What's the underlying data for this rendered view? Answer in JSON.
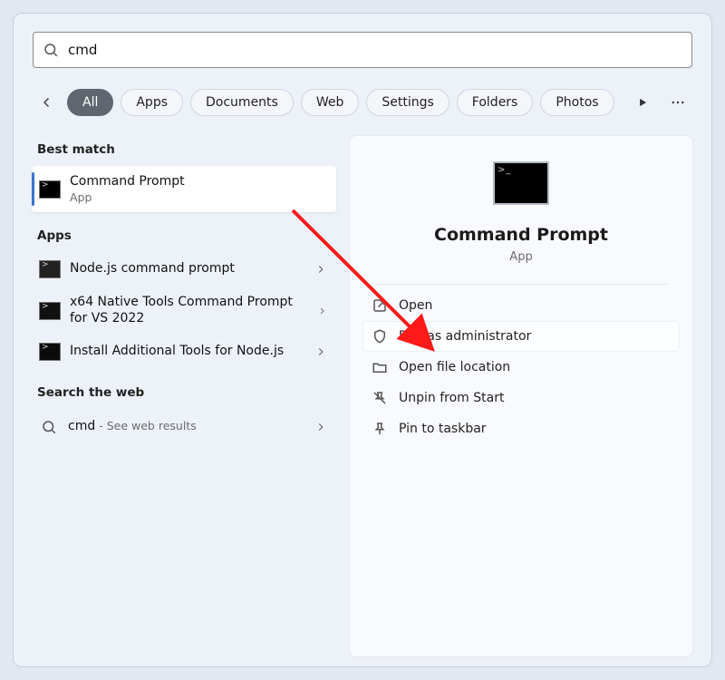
{
  "search": {
    "query": "cmd"
  },
  "filters": {
    "items": [
      "All",
      "Apps",
      "Documents",
      "Web",
      "Settings",
      "Folders",
      "Photos"
    ],
    "active_index": 0
  },
  "sections": {
    "best_match": "Best match",
    "apps": "Apps",
    "web": "Search the web"
  },
  "best": {
    "title": "Command Prompt",
    "subtitle": "App"
  },
  "apps": [
    {
      "title": "Node.js command prompt"
    },
    {
      "title": "x64 Native Tools Command Prompt for VS 2022"
    },
    {
      "title": "Install Additional Tools for Node.js"
    }
  ],
  "web": {
    "query": "cmd",
    "hint": "See web results"
  },
  "detail": {
    "title": "Command Prompt",
    "subtitle": "App",
    "actions": {
      "open": "Open",
      "run_admin": "Run as administrator",
      "open_loc": "Open file location",
      "unpin": "Unpin from Start",
      "pin_tb": "Pin to taskbar"
    }
  }
}
